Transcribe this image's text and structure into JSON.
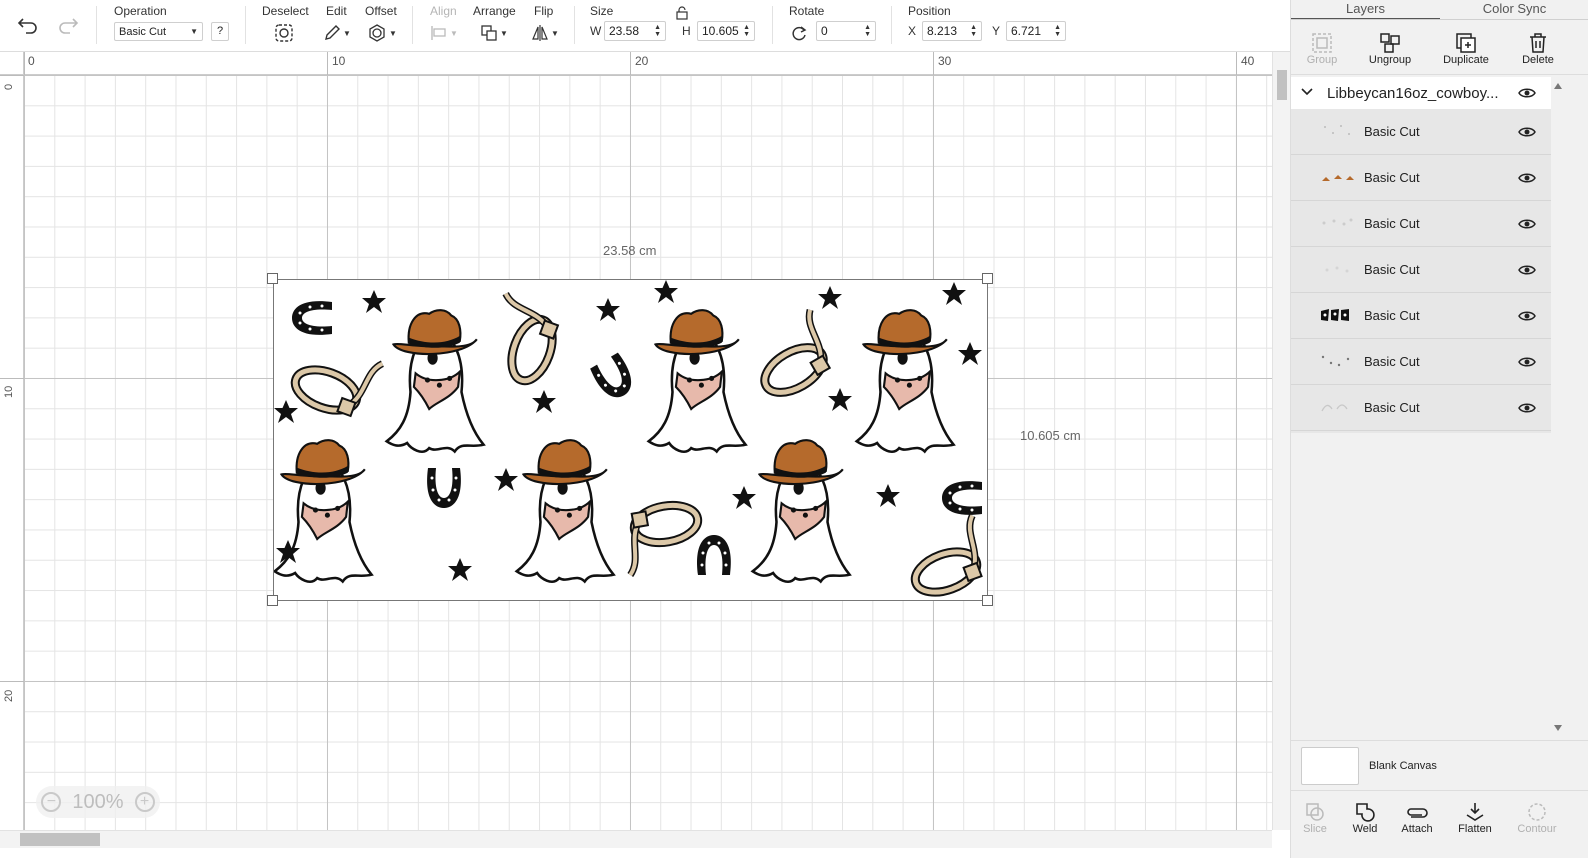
{
  "toolbar": {
    "undo_icon": "undo-icon",
    "redo_icon": "redo-icon",
    "operation_label": "Operation",
    "operation_value": "Basic Cut",
    "help_label": "?",
    "deselect_label": "Deselect",
    "edit_label": "Edit",
    "offset_label": "Offset",
    "align_label": "Align",
    "arrange_label": "Arrange",
    "flip_label": "Flip",
    "size_label": "Size",
    "width_prefix": "W",
    "width_value": "23.58",
    "height_prefix": "H",
    "height_value": "10.605",
    "rotate_label": "Rotate",
    "rotate_value": "0",
    "position_label": "Position",
    "x_prefix": "X",
    "x_value": "8.213",
    "y_prefix": "Y",
    "y_value": "6.721"
  },
  "ruler": {
    "top": [
      "0",
      "10",
      "20",
      "30",
      "40"
    ],
    "left": [
      "0",
      "10",
      "20"
    ]
  },
  "canvas": {
    "width_dimension": "23.58 cm",
    "height_dimension": "10.605 cm",
    "zoom": "100%"
  },
  "panel": {
    "tabs": [
      "Layers",
      "Color Sync"
    ],
    "actions": [
      "Group",
      "Ungroup",
      "Duplicate",
      "Delete"
    ],
    "group_name": "Libbeycan16oz_cowboy...",
    "layers": [
      {
        "name": "Basic Cut"
      },
      {
        "name": "Basic Cut"
      },
      {
        "name": "Basic Cut"
      },
      {
        "name": "Basic Cut"
      },
      {
        "name": "Basic Cut"
      },
      {
        "name": "Basic Cut"
      },
      {
        "name": "Basic Cut"
      }
    ],
    "blank_canvas": "Blank Canvas",
    "bottom_actions": [
      "Slice",
      "Weld",
      "Attach",
      "Flatten",
      "Contour"
    ]
  },
  "colors": {
    "hat_brown": "#b56a2c",
    "bandana_pink": "#e7b9ab",
    "rope_tan": "#dcc8a8",
    "ink": "#111111"
  }
}
